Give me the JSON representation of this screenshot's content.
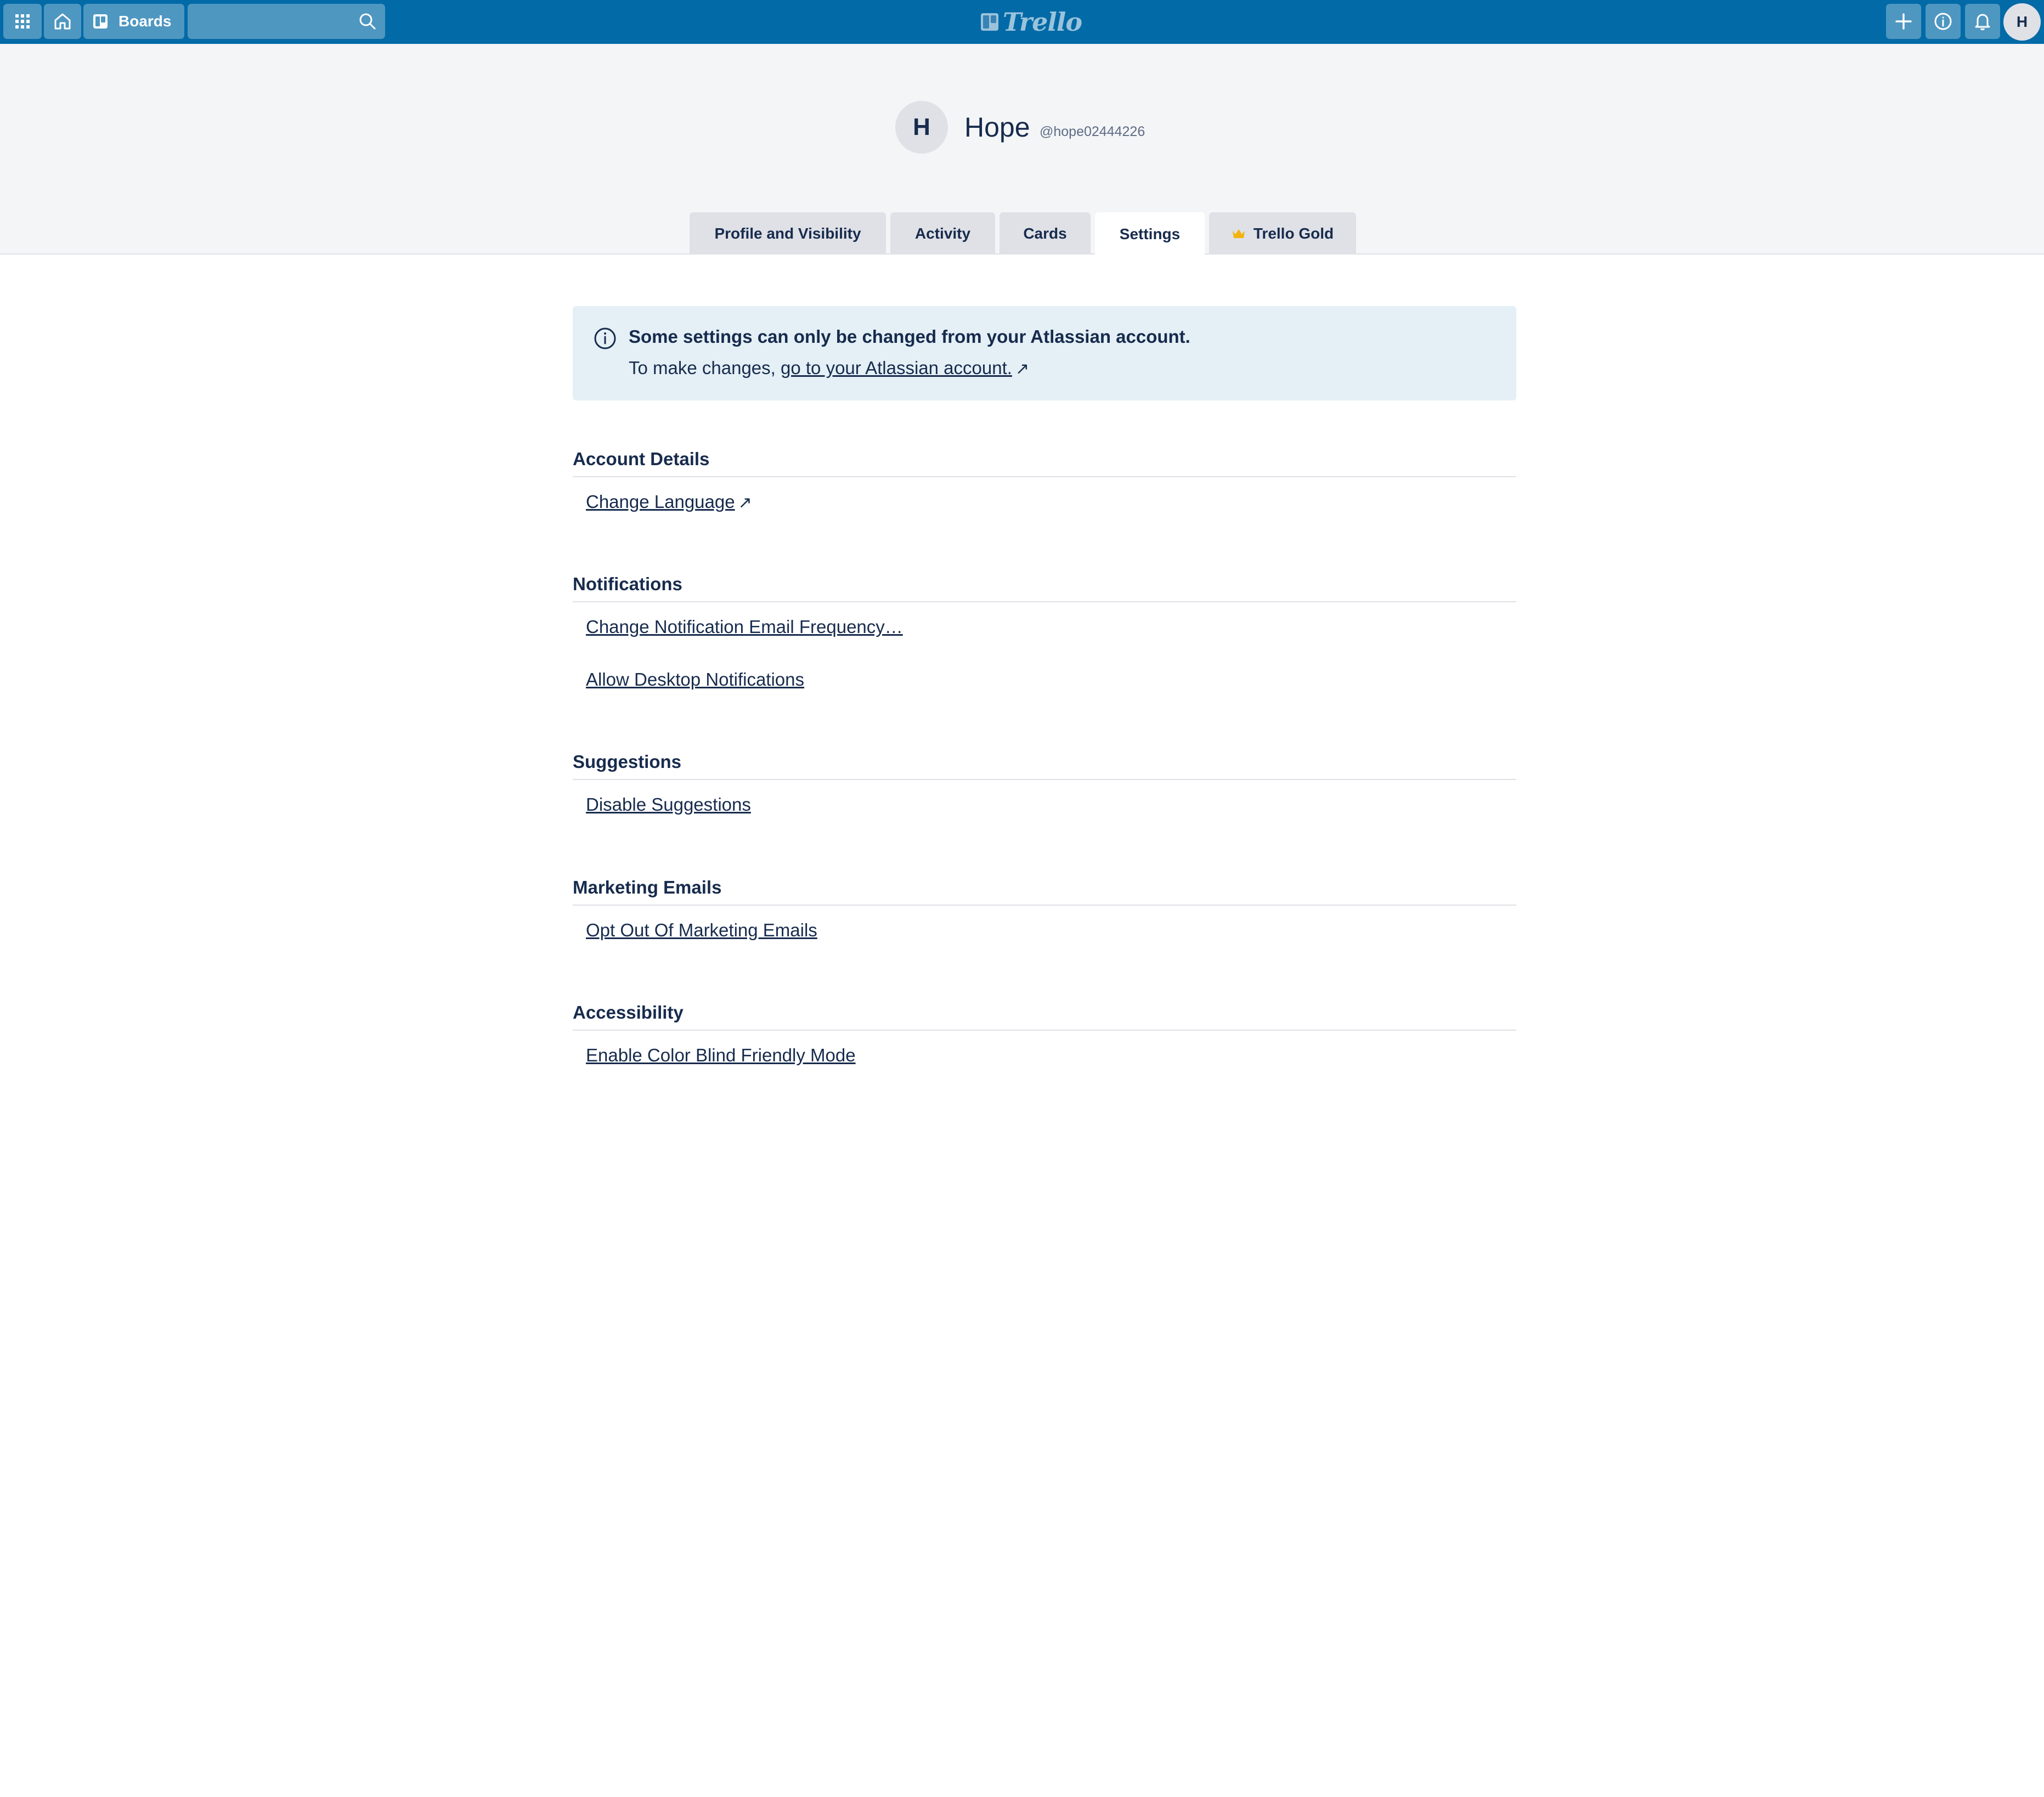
{
  "header": {
    "boards_label": "Boards",
    "search_placeholder": "",
    "logo_text": "Trello",
    "avatar_initial": "H",
    "brand_color": "#026aa7"
  },
  "profile": {
    "initial": "H",
    "name": "Hope",
    "username": "@hope02444226"
  },
  "tabs": [
    {
      "label": "Profile and Visibility"
    },
    {
      "label": "Activity"
    },
    {
      "label": "Cards"
    },
    {
      "label": "Settings",
      "active": true
    },
    {
      "label": "Trello Gold",
      "icon": "crown-icon"
    }
  ],
  "banner": {
    "title": "Some settings can only be changed from your Atlassian account.",
    "text_prefix": "To make changes,",
    "link_text": "go to your Atlassian account.",
    "arrow": "↗"
  },
  "sections": [
    {
      "title": "Account Details",
      "links": [
        {
          "label": "Change Language",
          "arrow": "↗"
        }
      ]
    },
    {
      "title": "Notifications",
      "links": [
        {
          "label": "Change Notification Email Frequency…"
        },
        {
          "label": "Allow Desktop Notifications"
        }
      ]
    },
    {
      "title": "Suggestions",
      "links": [
        {
          "label": "Disable Suggestions"
        }
      ]
    },
    {
      "title": "Marketing Emails",
      "links": [
        {
          "label": "Opt Out Of Marketing Emails"
        }
      ]
    },
    {
      "title": "Accessibility",
      "links": [
        {
          "label": "Enable Color Blind Friendly Mode"
        }
      ]
    }
  ]
}
